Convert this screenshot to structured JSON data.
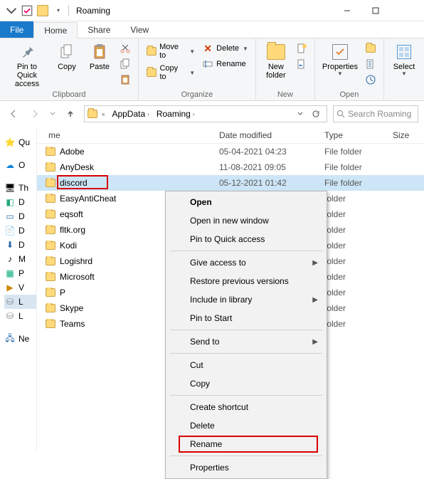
{
  "window": {
    "title": "Roaming"
  },
  "tabs": {
    "file": "File",
    "home": "Home",
    "share": "Share",
    "view": "View"
  },
  "ribbon": {
    "clipboard": {
      "label": "Clipboard",
      "pin": "Pin to Quick\naccess",
      "copy": "Copy",
      "paste": "Paste"
    },
    "organize": {
      "label": "Organize",
      "moveto": "Move to",
      "copyto": "Copy to",
      "delete": "Delete",
      "rename": "Rename"
    },
    "new": {
      "label": "New",
      "newfolder": "New\nfolder"
    },
    "open": {
      "label": "Open",
      "properties": "Properties"
    },
    "select": {
      "select": "Select"
    }
  },
  "address": {
    "segments": [
      "AppData",
      "Roaming"
    ]
  },
  "search": {
    "placeholder": "Search Roaming"
  },
  "columns": {
    "name": "me",
    "date": "Date modified",
    "type": "Type",
    "size": "Size"
  },
  "files": [
    {
      "name": "Adobe",
      "date": "05-04-2021 04:23",
      "type": "File folder"
    },
    {
      "name": "AnyDesk",
      "date": "11-08-2021 09:05",
      "type": "File folder"
    },
    {
      "name": "discord",
      "date": "05-12-2021 01:42",
      "type": "File folder"
    },
    {
      "name": "EasyAntiCheat",
      "date": "",
      "type": "folder"
    },
    {
      "name": "eqsoft",
      "date": "",
      "type": "folder"
    },
    {
      "name": "fltk.org",
      "date": "",
      "type": "folder"
    },
    {
      "name": "Kodi",
      "date": "",
      "type": "folder"
    },
    {
      "name": "Logishrd",
      "date": "",
      "type": "folder"
    },
    {
      "name": "Microsoft",
      "date": "",
      "type": "folder"
    },
    {
      "name": "P",
      "date": "",
      "type": "folder"
    },
    {
      "name": "Skype",
      "date": "",
      "type": "folder"
    },
    {
      "name": "Teams",
      "date": "",
      "type": "folder"
    }
  ],
  "sidebar": {
    "items": [
      "Qu",
      "O",
      "Th",
      "D",
      "D",
      "D",
      "D",
      "M",
      "P",
      "V",
      "L",
      "L",
      "Ne"
    ]
  },
  "context_menu": {
    "open": "Open",
    "open_new": "Open in new window",
    "pin_qa": "Pin to Quick access",
    "give_access": "Give access to",
    "restore": "Restore previous versions",
    "include_lib": "Include in library",
    "pin_start": "Pin to Start",
    "send_to": "Send to",
    "cut": "Cut",
    "copy": "Copy",
    "create_shortcut": "Create shortcut",
    "delete": "Delete",
    "rename": "Rename",
    "properties": "Properties"
  }
}
